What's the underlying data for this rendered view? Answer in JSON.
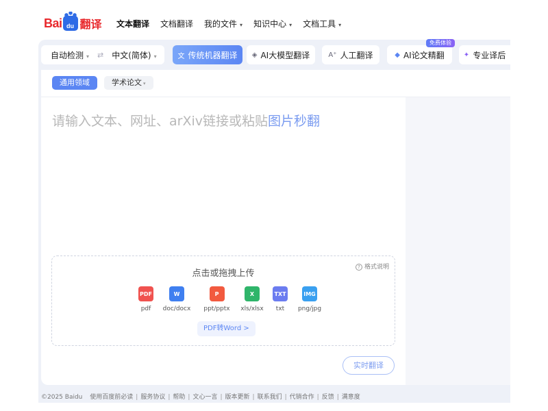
{
  "brand": {
    "bai": "Bai",
    "du": "du",
    "product": "翻译"
  },
  "nav": {
    "items": [
      {
        "label": "文本翻译",
        "active": true,
        "dropdown": false
      },
      {
        "label": "文档翻译",
        "active": false,
        "dropdown": false
      },
      {
        "label": "我的文件",
        "active": false,
        "dropdown": true
      },
      {
        "label": "知识中心",
        "active": false,
        "dropdown": true
      },
      {
        "label": "文档工具",
        "active": false,
        "dropdown": true
      }
    ],
    "caret": "▾"
  },
  "language": {
    "source": "自动检测",
    "target": "中文(简体)",
    "swap_icon": "⇄"
  },
  "modes": [
    {
      "label": "传统机器翻译",
      "icon": "文",
      "active": true
    },
    {
      "label": "AI大模型翻译",
      "icon": "◈",
      "active": false
    },
    {
      "label": "人工翻译",
      "icon": "A⁺",
      "active": false
    },
    {
      "label": "AI论文精翻",
      "icon": "◆",
      "active": false
    },
    {
      "label": "专业译后",
      "icon": "✦",
      "active": false
    }
  ],
  "free_badge": "免费体验",
  "subtabs": [
    {
      "label": "通用领域",
      "active": true
    },
    {
      "label": "学术论文",
      "active": false
    }
  ],
  "input": {
    "placeholder_main": "请输入文本、网址、arXiv链接或粘贴",
    "placeholder_link": "图片秒翻"
  },
  "upload": {
    "title": "点击或拖拽上传",
    "help": "格式说明",
    "filetypes": [
      {
        "label": "pdf",
        "color": "#f0524f",
        "glyph": "PDF"
      },
      {
        "label": "doc/docx",
        "color": "#3f7ff0",
        "glyph": "W"
      },
      {
        "label": "ppt/pptx",
        "color": "#f25a3f",
        "glyph": "P"
      },
      {
        "label": "xls/xlsx",
        "color": "#2fb56a",
        "glyph": "X"
      },
      {
        "label": "txt",
        "color": "#6b7cf0",
        "glyph": "TXT"
      },
      {
        "label": "png/jpg",
        "color": "#3aa0f0",
        "glyph": "IMG"
      }
    ],
    "pdf_to_word": "PDF转Word >"
  },
  "realtime_button": "实时翻译",
  "footer": {
    "copyright": "©2025 Baidu",
    "links": [
      "使用百度前必读",
      "服务协议",
      "帮助",
      "文心一言",
      "版本更新",
      "联系我们",
      "代销合作",
      "反馈",
      "满意度"
    ]
  }
}
